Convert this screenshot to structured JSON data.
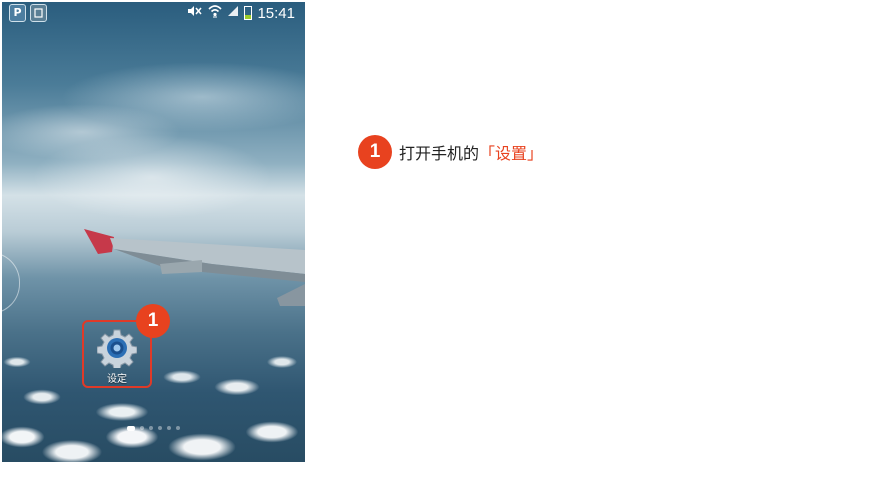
{
  "status_bar": {
    "app_icon_1": "P",
    "time": "15:41",
    "icons": [
      "app-p-icon",
      "sim-card-icon",
      "mute-icon",
      "wifi-icon",
      "signal-icon",
      "battery-icon"
    ]
  },
  "home_screen": {
    "app": {
      "label": "设定",
      "icon": "gear-icon"
    },
    "step_badge": "1",
    "page_indicator": {
      "count": 6,
      "active": 0
    }
  },
  "instruction": {
    "number": "1",
    "text": "打开手机的",
    "highlight": "「设置」"
  },
  "colors": {
    "accent": "#e8421f",
    "frame": "#e03a28"
  }
}
